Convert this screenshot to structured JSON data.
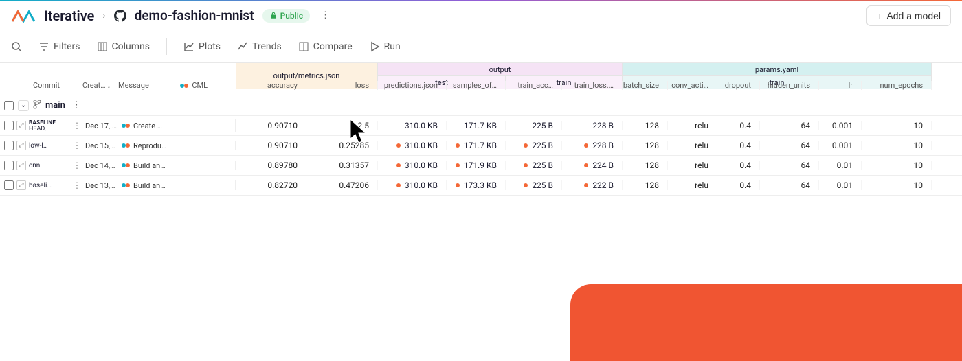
{
  "header": {
    "org": "Iterative",
    "repo": "demo-fashion-mnist",
    "visibility": "Public",
    "add_model": "Add a model"
  },
  "toolbar": {
    "filters": "Filters",
    "columns": "Columns",
    "plots": "Plots",
    "trends": "Trends",
    "compare": "Compare",
    "run": "Run"
  },
  "groups": {
    "metrics": "output/metrics.json",
    "output": "output",
    "params": "params.yaml",
    "test": "test",
    "train": "train"
  },
  "columns": {
    "commit": "Commit",
    "created": "Creat…",
    "message": "Message",
    "cml": "CML",
    "accuracy": "accuracy",
    "loss": "loss",
    "predictions": "predictions.json",
    "samples_of": "samples_of…",
    "train_acc": "train_acc…",
    "train_loss": "train_loss.…",
    "batch_size": "batch_size",
    "conv_activation": "conv_acti…",
    "dropout": "dropout",
    "hidden_units": "hidden_units",
    "lr": "lr",
    "num_epochs": "num_epochs"
  },
  "branch": {
    "name": "main"
  },
  "rows": [
    {
      "commit_top": "BASELINE",
      "commit_sub": "HEAD,…",
      "created": "Dec 17, …",
      "message": "Create …",
      "accuracy": "0.90710",
      "loss": "0.2   5",
      "predictions": "310.0 KB",
      "samples_of": "171.7 KB",
      "train_acc": "225 B",
      "train_loss": "228 B",
      "batch_size": "128",
      "conv_activation": "relu",
      "dropout": "0.4",
      "hidden_units": "64",
      "lr": "0.001",
      "num_epochs": "10",
      "show_dots": false
    },
    {
      "commit_top": "low-l…",
      "commit_sub": "",
      "created": "Dec 15,…",
      "message": "Reprodu…",
      "accuracy": "0.90710",
      "loss": "0.25285",
      "predictions": "310.0 KB",
      "samples_of": "171.7 KB",
      "train_acc": "225 B",
      "train_loss": "228 B",
      "batch_size": "128",
      "conv_activation": "relu",
      "dropout": "0.4",
      "hidden_units": "64",
      "lr": "0.001",
      "num_epochs": "10",
      "show_dots": true
    },
    {
      "commit_top": "cnn",
      "commit_sub": "",
      "created": "Dec 14,…",
      "message": "Build an…",
      "accuracy": "0.89780",
      "loss": "0.31357",
      "predictions": "310.0 KB",
      "samples_of": "171.9 KB",
      "train_acc": "225 B",
      "train_loss": "224 B",
      "batch_size": "128",
      "conv_activation": "relu",
      "dropout": "0.4",
      "hidden_units": "64",
      "lr": "0.01",
      "num_epochs": "10",
      "show_dots": true
    },
    {
      "commit_top": "baseli…",
      "commit_sub": "",
      "created": "Dec 13,…",
      "message": "Build an…",
      "accuracy": "0.82720",
      "loss": "0.47206",
      "predictions": "310.0 KB",
      "samples_of": "173.3 KB",
      "train_acc": "225 B",
      "train_loss": "222 B",
      "batch_size": "128",
      "conv_activation": "relu",
      "dropout": "0.4",
      "hidden_units": "64",
      "lr": "0.01",
      "num_epochs": "10",
      "show_dots": true
    }
  ]
}
